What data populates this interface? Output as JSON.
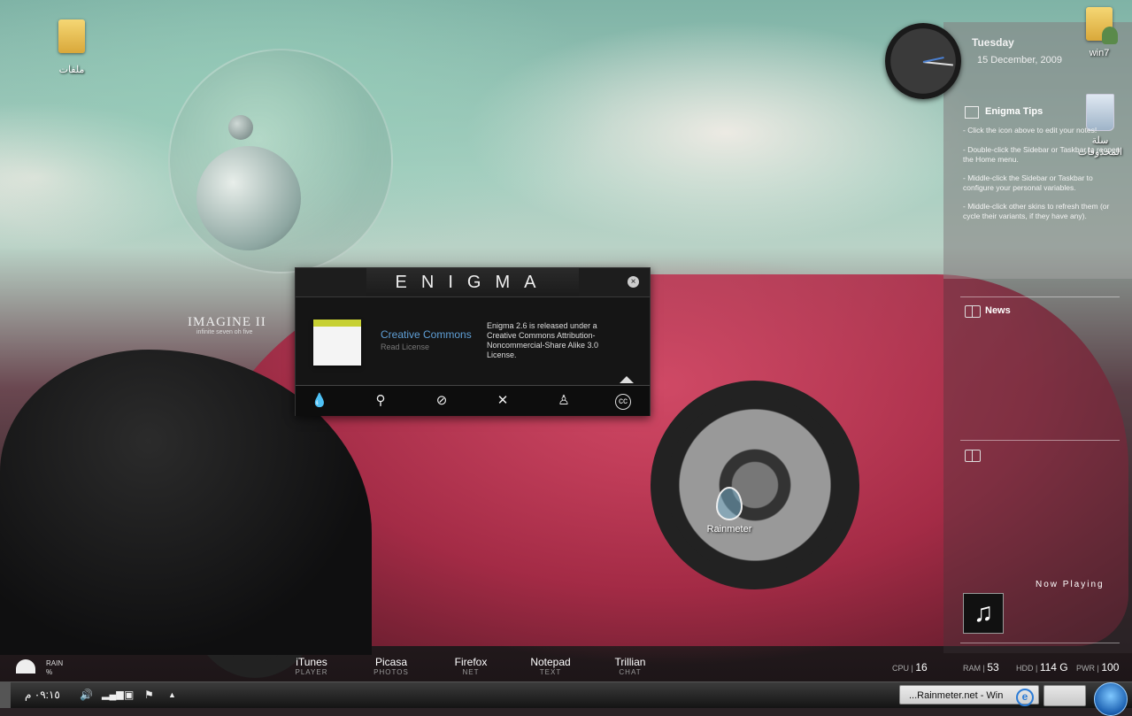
{
  "desktop": {
    "icons": [
      {
        "label": "ملفات"
      },
      {
        "label": "win7"
      },
      {
        "label": "سلة المحذوفات"
      },
      {
        "label": "Rainmeter"
      }
    ],
    "wallpaper_text": {
      "title": "IMAGINE II",
      "subtitle": "infinite seven oh five"
    }
  },
  "sidebar": {
    "day": "Tuesday",
    "date": "15 December, 2009",
    "tips_title": "Enigma Tips",
    "tips": [
      "- Click the icon above to edit your notes!",
      "- Double-click the Sidebar or Taskbar to reopen the Home menu.",
      "- Middle-click the Sidebar or Taskbar to configure your personal variables.",
      "- Middle-click other skins to refresh them (or cycle their variants, if they have any)."
    ],
    "news_title": "News",
    "now_playing": "Now Playing"
  },
  "enigma": {
    "title": "ENIGMA",
    "close": "×",
    "license_title": "Creative Commons",
    "license_sub": "Read License",
    "license_text": "Enigma 2.6 is released under a Creative Commons Attribution-Noncommercial-Share Alike 3.0 License.",
    "toolbar_icons": [
      "droplet-icon",
      "search-icon",
      "compass-icon",
      "tools-icon",
      "person-icon",
      "cc-icon"
    ]
  },
  "launcher": [
    {
      "name": "iTunes",
      "sub": "PLAYER"
    },
    {
      "name": "Picasa",
      "sub": "PHOTOS"
    },
    {
      "name": "Firefox",
      "sub": "NET"
    },
    {
      "name": "Notepad",
      "sub": "TEXT"
    },
    {
      "name": "Trillian",
      "sub": "CHAT"
    }
  ],
  "weather": {
    "label": "RAIN",
    "unit": "%"
  },
  "stats": {
    "cpu_label": "CPU",
    "cpu": "16",
    "ram_label": "RAM",
    "ram": "53",
    "hdd_label": "HDD",
    "hdd": "114 G",
    "pwr_label": "PWR",
    "pwr": "100"
  },
  "taskbar": {
    "time": "٠٩:١٥ م",
    "task_label": "...Rainmeter.net - Win"
  }
}
